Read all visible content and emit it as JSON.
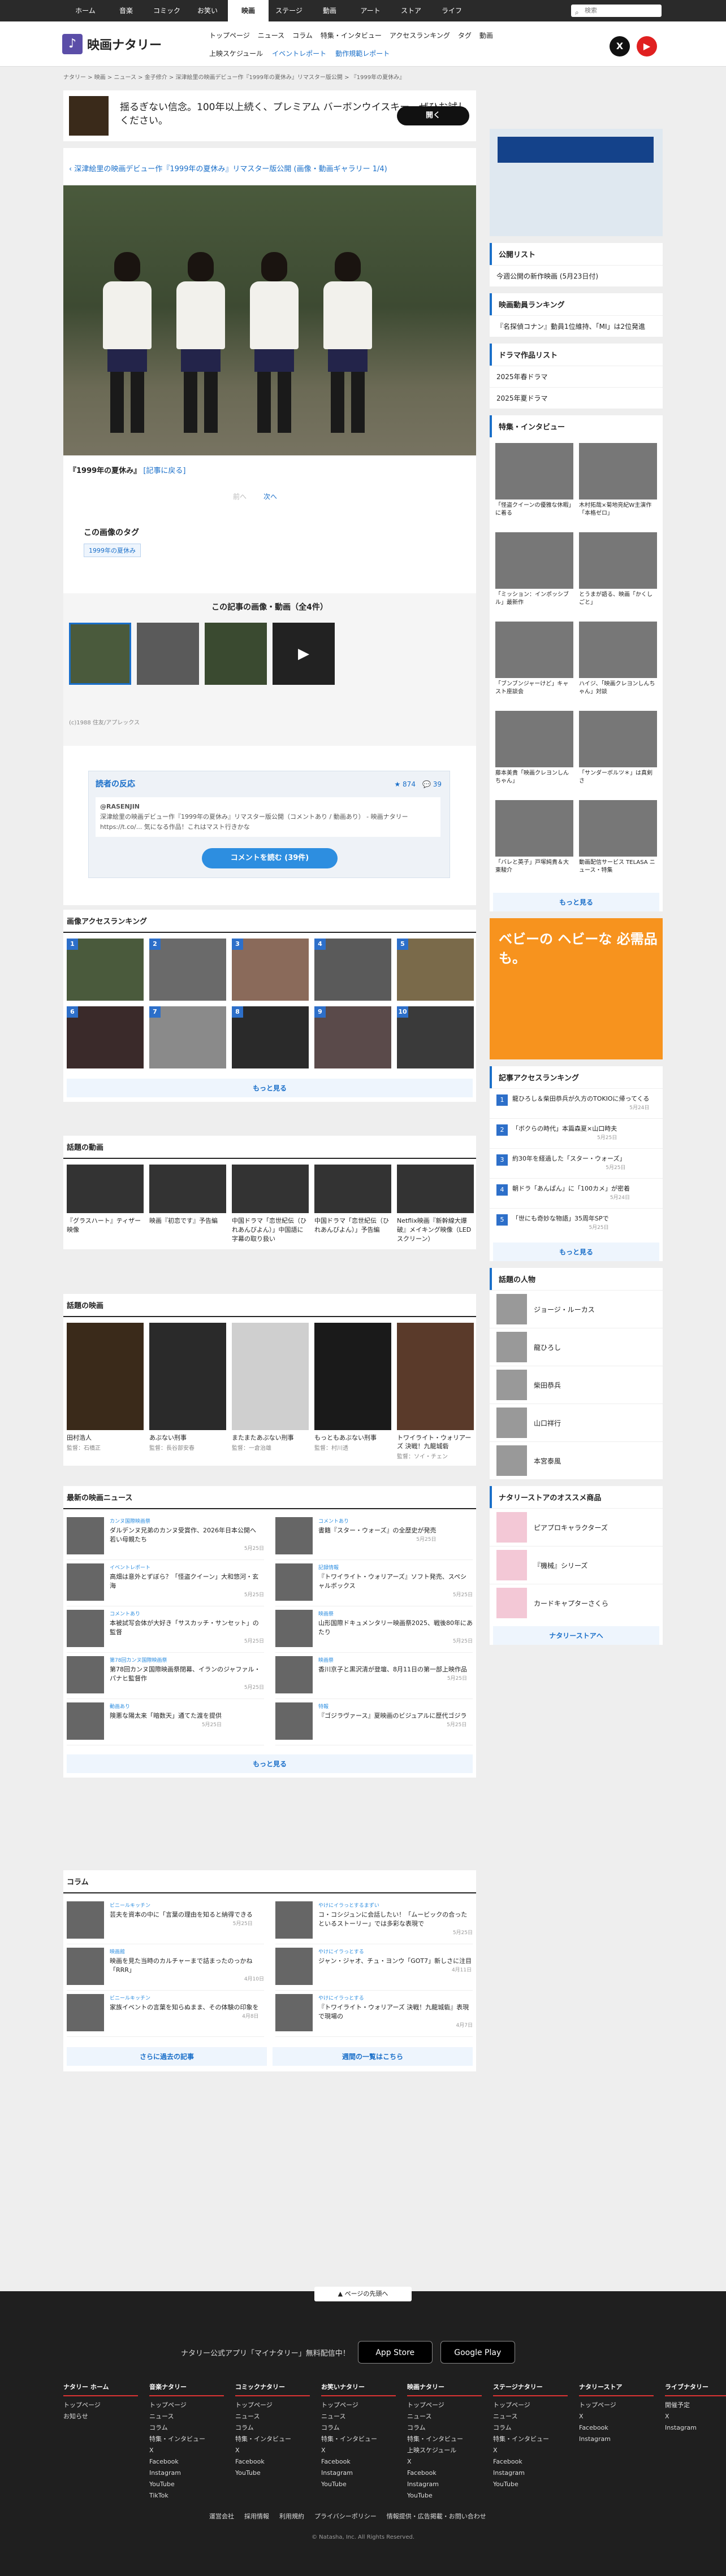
{
  "global_tabs": [
    "ホーム",
    "音楽",
    "コミック",
    "お笑い",
    "映画",
    "ステージ",
    "動画",
    "アート",
    "ストア",
    "ライフ"
  ],
  "search_placeholder": "検索",
  "site": {
    "name": "映画ナタリー",
    "logo_mark": "♪"
  },
  "nav_primary": [
    "トップページ",
    "ニュース",
    "コラム",
    "特集・インタビュー",
    "アクセスランキング",
    "タグ",
    "動画"
  ],
  "nav_secondary": [
    "上映スケジュール",
    "イベントレポート",
    "動作規範レポート"
  ],
  "breadcrumb": "ナタリー > 映画 > ニュース > 金子修介 > 深津絵里の映画デビュー作『1999年の夏休み』リマスター版公開 > 『1999年の夏休み』",
  "ad": {
    "text": "揺るぎない信念。100年以上続く、プレミアム バーボンウイスキー。ぜひお試しください。",
    "button": "開く"
  },
  "gallery_title": "深津絵里の映画デビュー作『1999年の夏休み』リマスター版公開 (画像・動画ギャラリー 1/4)",
  "caption": "『1999年の夏休み』",
  "caption_link": "[記事に戻る]",
  "pager_prev": "前へ",
  "pager_next": "次へ",
  "tags": {
    "title": "この画像のタグ",
    "items": [
      "1999年の夏休み"
    ]
  },
  "related": {
    "title": "この記事の画像・動画（全4件）",
    "copyright": "(c)1988 住友/アプレックス"
  },
  "reaction": {
    "title": "読者の反応",
    "likes": "874",
    "comments": "39",
    "quote": "深津絵里の映画デビュー作『1999年の夏休み』リマスター版公開（コメントあり / 動画あり） - 映画ナタリー https://t.co/... 気になる作品！これはマスト行きかな",
    "user": "@RASENJIN",
    "button": "コメントを読む (39件)"
  },
  "ranking": {
    "title": "画像アクセスランキング",
    "nums": [
      "1",
      "2",
      "3",
      "4",
      "5",
      "6",
      "7",
      "8",
      "9",
      "10"
    ],
    "more": "もっと見る"
  },
  "videos": {
    "title": "話題の動画",
    "items": [
      "『グラスハート』ティザー映像",
      "映画『初恋です』予告編",
      "中国ドラマ「恋世紀伝（ひれあんびよん）」中国語に字幕の取り扱い",
      "中国ドラマ「恋世紀伝（ひれあんびよん）」予告編",
      "Netflix映画『新幹線大爆破』メイキング映像（LEDスクリーン）"
    ]
  },
  "movies": {
    "title": "話題の映画",
    "items": [
      {
        "t": "田村浩人",
        "s": "監督：石橋正"
      },
      {
        "t": "あぶない刑事",
        "s": "監督：長谷部安春"
      },
      {
        "t": "またまたあぶない刑事",
        "s": "監督：一倉治雄"
      },
      {
        "t": "もっともあぶない刑事",
        "s": "監督：村川透"
      },
      {
        "t": "トワイライト・ウォリアーズ 決戦！九龍城砦",
        "s": "監督：ソイ・チェン"
      }
    ]
  },
  "news": {
    "title": "最新の映画ニュース",
    "items": [
      {
        "cat": "カンヌ国際映画祭",
        "t": "ダルデンヌ兄弟のカンヌ受賞作、2026年日本公開へ 若い母親たち",
        "m": "5月25日"
      },
      {
        "cat": "コメントあり",
        "t": "書籍『スター・ウォーズ』の全歴史が発売",
        "m": "5月25日"
      },
      {
        "cat": "イベントレポート",
        "t": "高畑は意外とずぼら？「怪盗クイーン」大和悠河・玄海",
        "m": "5月25日"
      },
      {
        "cat": "記録情報",
        "t": "『トワイライト・ウォリアーズ』ソフト発売、スペシャルボックス",
        "m": "5月25日"
      },
      {
        "cat": "コメントあり",
        "t": "本被試写会体が大好き「サスカッチ・サンセット」の監督",
        "m": "5月25日"
      },
      {
        "cat": "映画祭",
        "t": "山形国際ドキュメンタリー映画祭2025、戦後80年にあたり",
        "m": "5月25日"
      },
      {
        "cat": "第78回カンヌ国際映画祭",
        "t": "第78回カンヌ国際映画祭閉幕、イランのジャファル・パナヒ監督作",
        "m": "5月25日"
      },
      {
        "cat": "映画祭",
        "t": "香川京子と黒沢清が登壇、8月11日の第一部上映作品",
        "m": "5月25日"
      },
      {
        "cat": "動画あり",
        "t": "険悪な陽太来「暗数天」通てた渡を提供",
        "m": "5月25日"
      },
      {
        "cat": "特報",
        "t": "『ゴジラヴァース』夏映画のビジュアルに歴代ゴジラ",
        "m": "5月25日"
      }
    ],
    "more": "もっと見る"
  },
  "column": {
    "title": "コラム",
    "items": [
      {
        "cat": "ビニールキッチン",
        "t": "芸夫を資本の中に「言葉の理由を知ると納得できる",
        "m": "5月25日"
      },
      {
        "cat": "やけにイラっとするまずい",
        "t": "コ・コシジュンに会話したい！「ムービックの合ったといるストーリー」では多彩な表現で",
        "m": "5月25日"
      },
      {
        "cat": "映画館",
        "t": "映画を見た当時のカルチャーまで詰まったのっかね「RRR」",
        "m": "4月10日"
      },
      {
        "cat": "やけにイラっとする",
        "t": "ジャン・ジャオ、チュ・ヨンウ「GOT7」新しさに注目",
        "m": "4月11日"
      },
      {
        "cat": "ビニールキッチン",
        "t": "家族イベントの言葉を知らぬまま、その体験の印象を",
        "m": "4月8日"
      },
      {
        "cat": "やけにイラっとする",
        "t": "『トワイライト・ウォリアーズ 決戦！九龍城砦』表現で現場の",
        "m": "4月7日"
      }
    ],
    "btn_more": "さらに過去の記事",
    "btn_weekly": "週間の一覧はこちら"
  },
  "side": {
    "pub": {
      "title": "公開リスト",
      "items": [
        "今週公開の新作映画 (5月23日付)"
      ]
    },
    "rank": {
      "title": "映画動員ランキング",
      "items": [
        "『名探偵コナン』動員1位維持、「MI」は2位発進"
      ]
    },
    "drama": {
      "title": "ドラマ作品リスト",
      "items": [
        "2025年春ドラマ",
        "2025年夏ドラマ"
      ]
    },
    "feature": {
      "title": "特集・インタビュー",
      "items": [
        "「怪盗クイーンの優雅な休暇」に着る",
        "木村拓哉×菊地亮紀W主演作「本格ゼロ」",
        "「ミッション：インポッシブル」最新作",
        "とうまが語る、映画「かくしごと」",
        "「ブンブンジャーけど」キャスト座談会",
        "ハイジ、「映画クレヨンしんちゃん」対談",
        "藤本美貴「映画クレヨンしんちゃん」",
        "「サンダーボルツ＊」は真剣さ",
        "「バレと英子」戸塚純貴＆大東駿介",
        "動画配信サービス TELASA ニュース・特集"
      ],
      "more": "もっと見る"
    },
    "side_ad": "ベビーの ヘビーな 必需品も。",
    "rank2": {
      "title": "記事アクセスランキング",
      "items": [
        {
          "t": "龍ひろし＆柴田恭兵が久方のTOKIOに帰ってくる",
          "m": "5月24日"
        },
        {
          "t": "「ボクらの時代」本篇森夏×山口時夫",
          "m": "5月25日"
        },
        {
          "t": "約30年を経過した「スター・ウォーズ」",
          "m": "5月25日"
        },
        {
          "t": "朝ドラ「あんぱん」に「100カメ」が密着",
          "m": "5月24日"
        },
        {
          "t": "「世にも奇妙な物語」35周年SPで",
          "m": "5月25日"
        }
      ],
      "more": "もっと見る"
    },
    "people": {
      "title": "話題の人物",
      "items": [
        "ジョージ・ルーカス",
        "龍ひろし",
        "柴田恭兵",
        "山口祥行",
        "本宮泰風"
      ]
    },
    "store": {
      "title": "ナタリーストアのオススメ商品",
      "items": [
        "ピアプロキャラクターズ",
        "『機械』シリーズ",
        "カードキャプターさくら"
      ],
      "more": "ナタリーストアへ"
    }
  },
  "footer": {
    "pagetop": "ページの先頭へ",
    "app_text": "ナタリー公式アプリ「マイナタリー」無料配信中！",
    "app_store": "App Store",
    "google_play": "Google Play",
    "cols": [
      {
        "h": "ナタリー ホーム",
        "l": [
          "トップページ",
          "お知らせ"
        ]
      },
      {
        "h": "音楽ナタリー",
        "l": [
          "トップページ",
          "ニュース",
          "コラム",
          "特集・インタビュー",
          "X",
          "Facebook",
          "Instagram",
          "YouTube",
          "TikTok"
        ]
      },
      {
        "h": "コミックナタリー",
        "l": [
          "トップページ",
          "ニュース",
          "コラム",
          "特集・インタビュー",
          "X",
          "Facebook",
          "YouTube"
        ]
      },
      {
        "h": "お笑いナタリー",
        "l": [
          "トップページ",
          "ニュース",
          "コラム",
          "特集・インタビュー",
          "X",
          "Facebook",
          "Instagram",
          "YouTube"
        ]
      },
      {
        "h": "映画ナタリー",
        "l": [
          "トップページ",
          "ニュース",
          "コラム",
          "特集・インタビュー",
          "上映スケジュール",
          "X",
          "Facebook",
          "Instagram",
          "YouTube"
        ]
      },
      {
        "h": "ステージナタリー",
        "l": [
          "トップページ",
          "ニュース",
          "コラム",
          "特集・インタビュー",
          "X",
          "Facebook",
          "Instagram",
          "YouTube"
        ]
      },
      {
        "h": "ナタリーストア",
        "l": [
          "トップページ",
          "X",
          "Facebook",
          "Instagram"
        ]
      },
      {
        "h": "ライブナタリー",
        "l": [
          "開催予定",
          "X",
          "Instagram"
        ]
      }
    ],
    "links": [
      "運営会社",
      "採用情報",
      "利用規約",
      "プライバシーポリシー",
      "情報提供・広告掲載・お問い合わせ"
    ],
    "copyright": "© Natasha, Inc. All Rights Reserved."
  }
}
